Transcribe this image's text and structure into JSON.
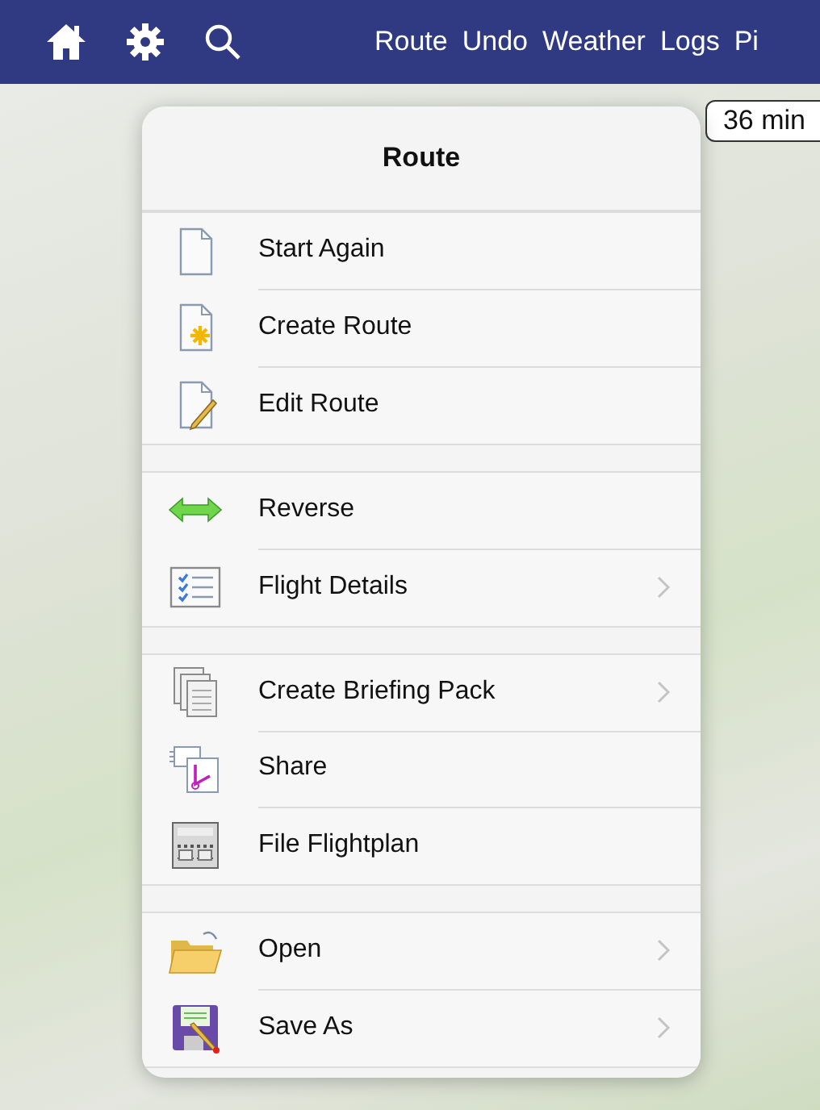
{
  "nav_bar": {
    "items": [
      "Route",
      "Undo",
      "Weather",
      "Logs",
      "Pi"
    ]
  },
  "map": {
    "duration_label": "36 min"
  },
  "popover": {
    "title": "Route",
    "groups": [
      {
        "items": [
          {
            "label": "Start Again",
            "kind": "blank-doc",
            "chevron": false
          },
          {
            "label": "Create Route",
            "kind": "new-doc",
            "chevron": false
          },
          {
            "label": "Edit Route",
            "kind": "edit-doc",
            "chevron": false
          }
        ]
      },
      {
        "items": [
          {
            "label": "Reverse",
            "kind": "reverse",
            "chevron": false
          },
          {
            "label": "Flight Details",
            "kind": "checklist",
            "chevron": true
          }
        ]
      },
      {
        "items": [
          {
            "label": "Create Briefing Pack",
            "kind": "pages",
            "chevron": true
          },
          {
            "label": "Share",
            "kind": "share",
            "chevron": false
          },
          {
            "label": "File Flightplan",
            "kind": "flightplan",
            "chevron": false
          }
        ]
      },
      {
        "items": [
          {
            "label": "Open",
            "kind": "folder",
            "chevron": true
          },
          {
            "label": "Save As",
            "kind": "save",
            "chevron": true
          }
        ]
      }
    ]
  }
}
